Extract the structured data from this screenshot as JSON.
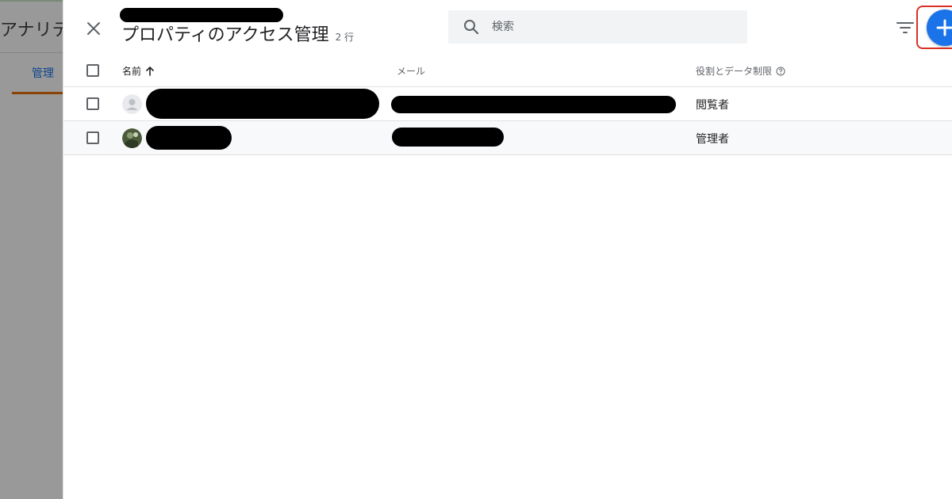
{
  "background_app": {
    "title": "アナリテ",
    "tab_label": "管理"
  },
  "panel": {
    "title": "プロパティのアクセス管理",
    "row_count": "2 行",
    "search": {
      "placeholder": "検索",
      "value": ""
    }
  },
  "table": {
    "columns": {
      "name": "名前",
      "email": "メール",
      "role": "役割とデータ制限"
    },
    "rows": [
      {
        "role": "閲覧者"
      },
      {
        "role": "管理者"
      }
    ]
  },
  "colors": {
    "accent_blue": "#1a73e8",
    "highlight_red": "#d93025",
    "tab_underline_orange": "#e8710a"
  },
  "icons": [
    "close-icon",
    "search-icon",
    "filter-icon",
    "add-icon",
    "sort-ascending-icon",
    "help-icon",
    "default-avatar-icon"
  ]
}
